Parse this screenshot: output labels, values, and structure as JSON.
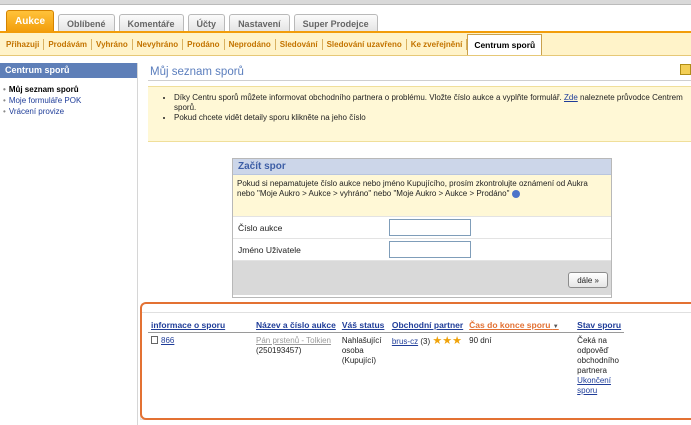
{
  "main_tabs": [
    {
      "label": "Aukce",
      "active": true
    },
    {
      "label": "Oblíbené",
      "active": false
    },
    {
      "label": "Komentáře",
      "active": false
    },
    {
      "label": "Účty",
      "active": false
    },
    {
      "label": "Nastavení",
      "active": false
    },
    {
      "label": "Super Prodejce",
      "active": false
    }
  ],
  "sub_tabs": [
    {
      "label": "Přihazuji",
      "active": false
    },
    {
      "label": "Prodávám",
      "active": false
    },
    {
      "label": "Vyhráno",
      "active": false
    },
    {
      "label": "Nevyhráno",
      "active": false
    },
    {
      "label": "Prodáno",
      "active": false
    },
    {
      "label": "Neprodáno",
      "active": false
    },
    {
      "label": "Sledování",
      "active": false
    },
    {
      "label": "Sledování uzavřeno",
      "active": false
    },
    {
      "label": "Ke zveřejnění",
      "active": false
    },
    {
      "label": "Centrum sporů",
      "active": true
    }
  ],
  "sidebar": {
    "title": "Centrum sporů",
    "items": [
      {
        "label": "Můj seznam sporů",
        "current": true
      },
      {
        "label": "Moje formuláře POK",
        "current": false
      },
      {
        "label": "Vrácení provize",
        "current": false
      }
    ]
  },
  "page": {
    "title": "Můj seznam sporů"
  },
  "info": {
    "bullet1_part1": "Díky Centru sporů můžete informovat obchodního partnera o problému. Vložte číslo aukce a vyplňte formulář.",
    "bullet1_link": "Zde",
    "bullet1_part2": "naleznete průvodce Centrem sporů.",
    "bullet2": "Pokud chcete vidět detaily sporu klikněte na jeho číslo"
  },
  "start_dispute": {
    "title": "Začít spor",
    "description": "Pokud si nepamatujete číslo aukce nebo jméno Kupujícího, prosím zkontrolujte oznámení od Aukra nebo \"Moje Aukro > Aukce > vyhráno\" nebo \"Moje Aukro > Aukce > Prodáno\"",
    "auction_label": "Číslo aukce",
    "auction_value": "",
    "user_label": "Jméno Uživatele",
    "user_value": "",
    "next_button": "dále »"
  },
  "table": {
    "columns": [
      "informace o sporu",
      "Název a číslo aukce",
      "Váš status",
      "Obchodní partner",
      "Čas do konce sporu",
      "Stav sporu"
    ],
    "sort_indicator": "▼",
    "rows": [
      {
        "dispute_id": "866",
        "auction_name": "Pán prstenů - Tolkien",
        "auction_number": "(250193457)",
        "status": "Nahlašující osoba (Kupující)",
        "partner": "brus-cz",
        "partner_rating": "(3)",
        "time_left": "90 dní",
        "state_text": "Čeká na odpověď obchodního partnera",
        "state_link": "Ukončení sporu"
      }
    ]
  },
  "colors": {
    "accent": "#f29d0a",
    "highlight": "#e37133",
    "sidebar_head": "#5e7fb8",
    "link": "#1f3d99"
  }
}
